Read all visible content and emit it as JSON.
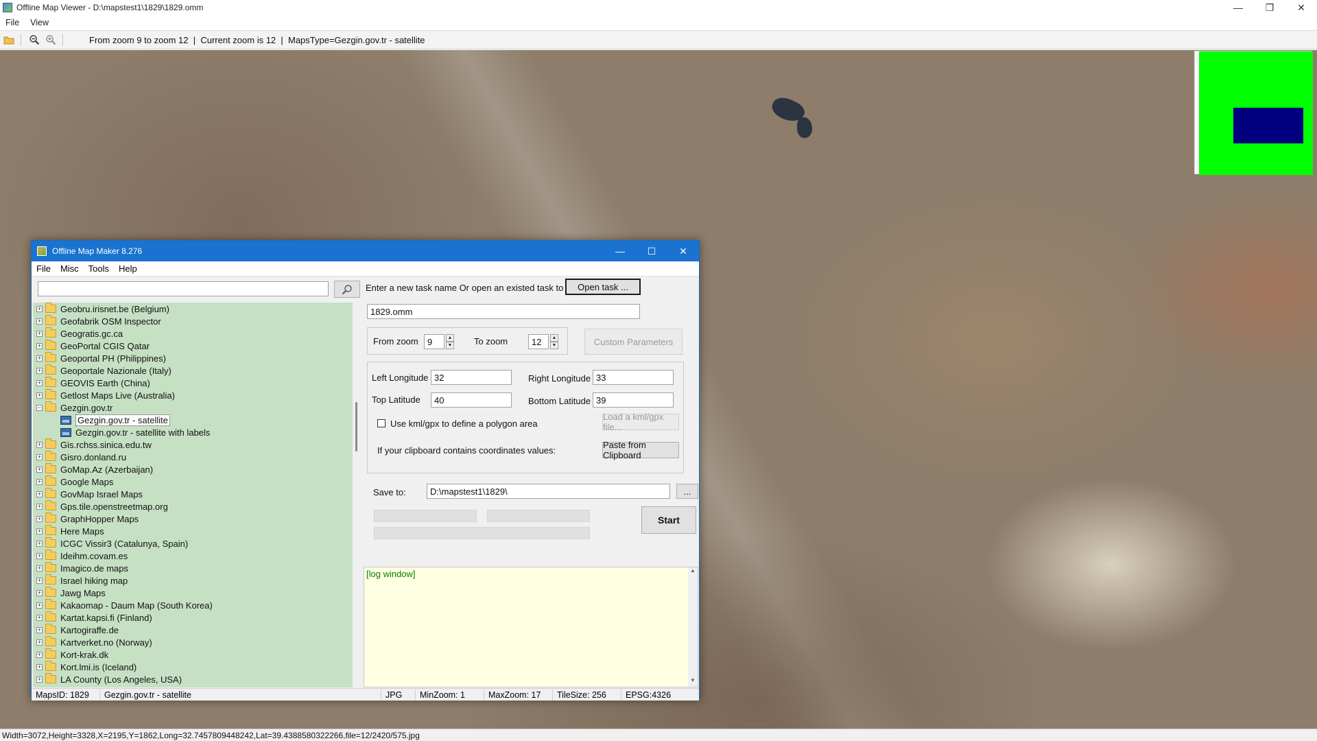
{
  "window": {
    "title": "Offline Map Viewer - D:\\mapstest1\\1829\\1829.omm",
    "controls": [
      "—",
      "❐",
      "✕"
    ]
  },
  "menu": [
    "File",
    "View"
  ],
  "toolbar": {
    "zoom_range": "From zoom 9 to zoom 12",
    "current_zoom": "Current zoom is 12",
    "maps_type": "MapsType=Gezgin.gov.tr - satellite",
    "icons": [
      "open-folder-icon",
      "zoom-out-icon",
      "zoom-in-icon"
    ]
  },
  "statusbar": {
    "text": "Width=3072,Height=3328,X=2195,Y=1862,Long=32.7457809448242,Lat=39.4388580322266,file=12/2420/575.jpg"
  },
  "minimap": {
    "background": "#00ff00",
    "viewport": "#00007f"
  },
  "dialog": {
    "title": "Offline Map Maker 8.276",
    "controls": [
      "—",
      "☐",
      "✕"
    ],
    "menu": [
      "File",
      "Misc",
      "Tools",
      "Help"
    ],
    "search": {
      "value": "",
      "placeholder": ""
    },
    "tree": [
      {
        "label": "Geobru.irisnet.be (Belgium)",
        "expander": "+"
      },
      {
        "label": "Geofabrik OSM Inspector",
        "expander": "+"
      },
      {
        "label": "Geogratis.gc.ca",
        "expander": "+"
      },
      {
        "label": "GeoPortal CGIS Qatar",
        "expander": "+"
      },
      {
        "label": "Geoportal PH (Philippines)",
        "expander": "+"
      },
      {
        "label": "Geoportale Nazionale (Italy)",
        "expander": "+"
      },
      {
        "label": "GEOVIS Earth (China)",
        "expander": "+"
      },
      {
        "label": "Getlost Maps Live (Australia)",
        "expander": "+"
      },
      {
        "label": "Gezgin.gov.tr",
        "expander": "−"
      },
      {
        "label": "Gezgin.gov.tr - satellite",
        "child": true,
        "selected": true
      },
      {
        "label": "Gezgin.gov.tr - satellite with labels",
        "child": true
      },
      {
        "label": "Gis.rchss.sinica.edu.tw",
        "expander": "+"
      },
      {
        "label": "Gisro.donland.ru",
        "expander": "+"
      },
      {
        "label": "GoMap.Az (Azerbaijan)",
        "expander": "+"
      },
      {
        "label": "Google Maps",
        "expander": "+"
      },
      {
        "label": "GovMap Israel Maps",
        "expander": "+"
      },
      {
        "label": "Gps.tile.openstreetmap.org",
        "expander": "+"
      },
      {
        "label": "GraphHopper Maps",
        "expander": "+"
      },
      {
        "label": "Here Maps",
        "expander": "+"
      },
      {
        "label": "ICGC Vissir3 (Catalunya, Spain)",
        "expander": "+"
      },
      {
        "label": "Ideihm.covam.es",
        "expander": "+"
      },
      {
        "label": "Imagico.de maps",
        "expander": "+"
      },
      {
        "label": "Israel hiking map",
        "expander": "+"
      },
      {
        "label": "Jawg Maps",
        "expander": "+"
      },
      {
        "label": "Kakaomap - Daum Map (South Korea)",
        "expander": "+"
      },
      {
        "label": "Kartat.kapsi.fi (Finland)",
        "expander": "+"
      },
      {
        "label": "Kartogiraffe.de",
        "expander": "+"
      },
      {
        "label": "Kartverket.no (Norway)",
        "expander": "+"
      },
      {
        "label": "Kort-krak.dk",
        "expander": "+"
      },
      {
        "label": "Kort.lmi.is (Iceland)",
        "expander": "+"
      },
      {
        "label": "LA County (Los Angeles, USA)",
        "expander": "+"
      }
    ],
    "task_prompt": "Enter a new task name Or open an existed task to continue:",
    "open_task_label": "Open task ...",
    "task_name": "1829.omm",
    "from_zoom_label": "From zoom",
    "from_zoom_value": "9",
    "to_zoom_label": "To zoom",
    "to_zoom_value": "12",
    "custom_params_label": "Custom Parameters",
    "left_long_label": "Left Longitude",
    "left_long_value": "32",
    "right_long_label": "Right Longitude",
    "right_long_value": "33",
    "top_lat_label": "Top Latitude",
    "top_lat_value": "40",
    "bottom_lat_label": "Bottom Latitude",
    "bottom_lat_value": "39",
    "kml_checkbox_label": "Use kml/gpx to define a polygon area",
    "kml_checked": false,
    "load_kml_label": "Load a kml/gpx file...",
    "clipboard_prompt": "If your clipboard contains coordinates values:",
    "paste_label": "Paste from Clipboard",
    "save_to_label": "Save to:",
    "save_to_value": "D:\\mapstest1\\1829\\",
    "browse_label": "...",
    "start_label": "Start",
    "progress": [
      0,
      0,
      0
    ],
    "log_text": "[log window]",
    "status": {
      "maps_id": "MapsID: 1829",
      "maps_name": "Gezgin.gov.tr - satellite",
      "format": "JPG",
      "min_zoom": "MinZoom: 1",
      "max_zoom": "MaxZoom: 17",
      "tile_size": "TileSize: 256",
      "epsg": "EPSG:4326"
    }
  }
}
